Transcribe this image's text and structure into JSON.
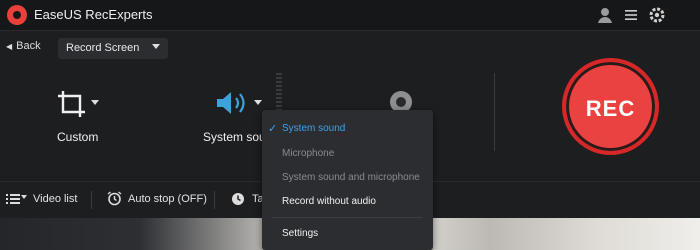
{
  "app": {
    "title": "EaseUS RecExperts"
  },
  "toolbar": {
    "back_label": "Back",
    "mode_label": "Record Screen"
  },
  "capture": {
    "region_label": "Custom",
    "audio_label": "System sou",
    "rec_label": "REC"
  },
  "bottombar": {
    "video_list_label": "Video list",
    "auto_stop_label": "Auto stop (OFF)",
    "task_label": "Ta"
  },
  "audio_menu": {
    "items": [
      {
        "label": "System sound",
        "selected": true
      },
      {
        "label": "Microphone",
        "enabled": false
      },
      {
        "label": "System sound and microphone",
        "enabled": false
      },
      {
        "label": "Record without audio",
        "enabled": true
      },
      {
        "label": "Settings",
        "enabled": true
      }
    ],
    "checkmark": "✓"
  },
  "colors": {
    "accent": "#3aa3f0",
    "rec": "#ea4141",
    "speaker": "#3aa3d9"
  }
}
